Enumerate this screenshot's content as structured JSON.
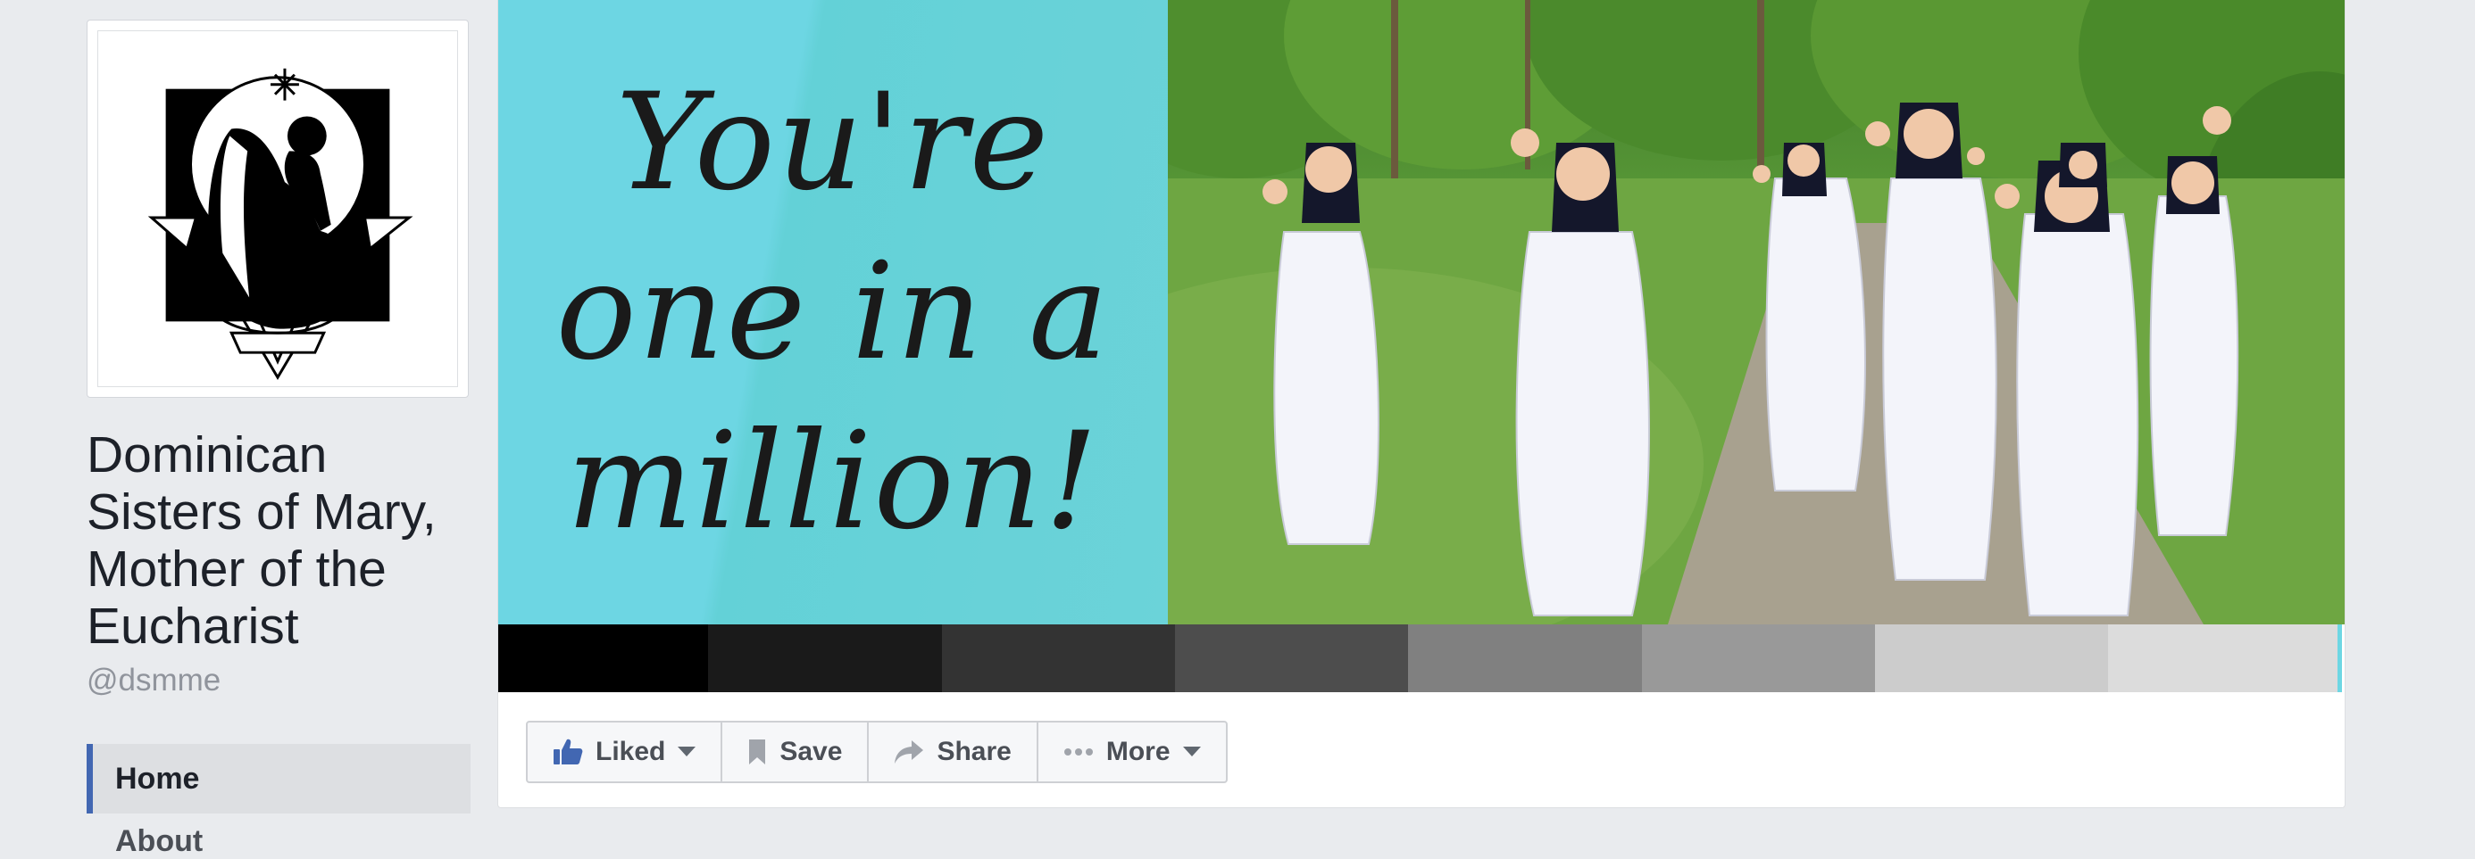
{
  "page": {
    "name": "Dominican Sisters of Mary, Mother of the Eucharist",
    "handle": "@dsmme"
  },
  "nav": {
    "items": [
      {
        "label": "Home",
        "active": true
      },
      {
        "label": "About",
        "active": false
      }
    ]
  },
  "cover": {
    "lines": [
      "You're",
      "one in a",
      "million!"
    ],
    "swatches": [
      "#000000",
      "#1a1a1a",
      "#333333",
      "#4d4d4d",
      "#808080",
      "#999999",
      "#cccccc",
      "#dcdcdc"
    ]
  },
  "actions": {
    "liked": "Liked",
    "save": "Save",
    "share": "Share",
    "more": "More"
  },
  "icons": {
    "liked": "thumbs-up-icon",
    "save": "bookmark-icon",
    "share": "share-arrow-icon",
    "more": "more-dots-icon",
    "dropdown": "caret-down-icon"
  },
  "colors": {
    "accent": "#4267b2",
    "background": "#e9ebee",
    "cover_teal": "#6dd6e3"
  }
}
